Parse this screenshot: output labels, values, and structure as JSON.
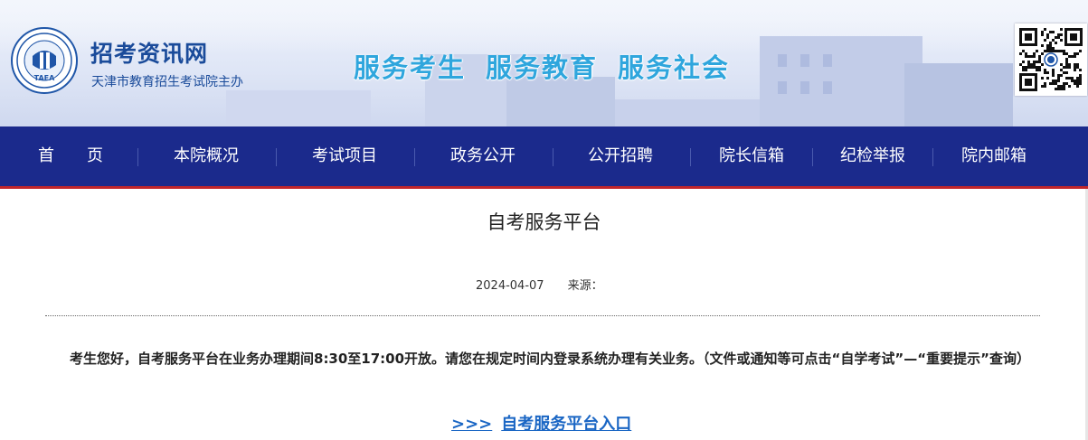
{
  "header": {
    "site_name": "招考资讯网",
    "site_sub": "天津市教育招生考试院主办",
    "emblem_text": "TAEA",
    "slogans": [
      "服务考生",
      "服务教育",
      "服务社会"
    ],
    "colors": {
      "site_name": "#1a4b9a",
      "slogan": "#2fa6dd"
    },
    "qr_icon": "qr-code-icon"
  },
  "nav": {
    "items": [
      "首　　页",
      "本院概况",
      "考试项目",
      "政务公开",
      "公开招聘",
      "院长信箱",
      "纪检举报",
      "院内邮箱"
    ],
    "colors": {
      "background": "#1b2a8c",
      "accent_border": "#c0262b",
      "text": "#ffffff"
    }
  },
  "article": {
    "title": "自考服务平台",
    "date": "2024-04-07",
    "source_label": "来源：",
    "body": "考生您好，自考服务平台在业务办理期间8:30至17:00开放。请您在规定时间内登录系统办理有关业务。（文件或通知等可点击“自学考试”—“重要提示”查询）",
    "link_arrows": ">>>",
    "link_label": "自考服务平台入口",
    "colors": {
      "link": "#1a66c4"
    }
  }
}
